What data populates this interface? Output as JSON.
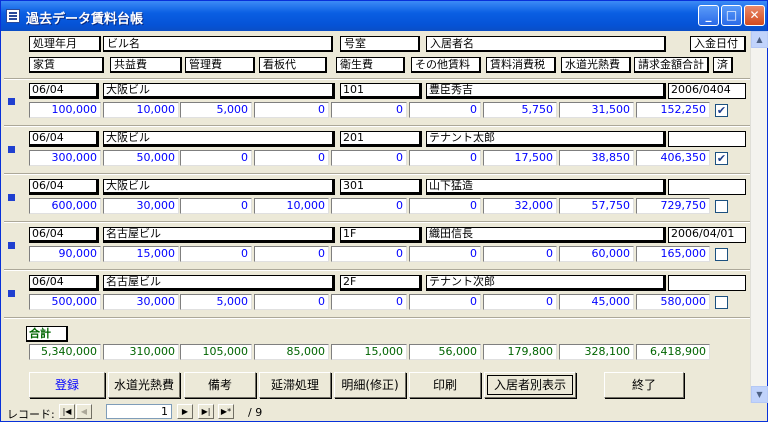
{
  "window": {
    "title": "過去データ賃料台帳",
    "min": "_",
    "max": "□",
    "close": "✕"
  },
  "headers": {
    "row1": [
      "処理年月",
      "ビル名",
      "号室",
      "入居者名",
      "入金日付"
    ],
    "row2": [
      "家賃",
      "共益費",
      "管理費",
      "看板代",
      "衛生費",
      "その他賃料",
      "賃料消費税",
      "水道光熱費",
      "請求金額合計",
      "済"
    ]
  },
  "records": [
    {
      "ym": "06/04",
      "building": "大阪ビル",
      "room": "101",
      "tenant": "豊臣秀吉",
      "date": "2006/0404",
      "values": [
        "100,000",
        "10,000",
        "5,000",
        "0",
        "0",
        "0",
        "5,750",
        "31,500",
        "152,250"
      ],
      "checked": true
    },
    {
      "ym": "06/04",
      "building": "大阪ビル",
      "room": "201",
      "tenant": "テナント太郎",
      "date": "",
      "values": [
        "300,000",
        "50,000",
        "0",
        "0",
        "0",
        "0",
        "17,500",
        "38,850",
        "406,350"
      ],
      "checked": true
    },
    {
      "ym": "06/04",
      "building": "大阪ビル",
      "room": "301",
      "tenant": "山下猛造",
      "date": "",
      "values": [
        "600,000",
        "30,000",
        "0",
        "10,000",
        "0",
        "0",
        "32,000",
        "57,750",
        "729,750"
      ],
      "checked": false
    },
    {
      "ym": "06/04",
      "building": "名古屋ビル",
      "room": "1F",
      "tenant": "織田信長",
      "date": "2006/04/01",
      "values": [
        "90,000",
        "15,000",
        "0",
        "0",
        "0",
        "0",
        "0",
        "60,000",
        "165,000"
      ],
      "checked": false
    },
    {
      "ym": "06/04",
      "building": "名古屋ビル",
      "room": "2F",
      "tenant": "テナント次郎",
      "date": "",
      "values": [
        "500,000",
        "30,000",
        "5,000",
        "0",
        "0",
        "0",
        "0",
        "45,000",
        "580,000"
      ],
      "checked": false
    }
  ],
  "totals": {
    "label": "合計",
    "values": [
      "5,340,000",
      "310,000",
      "105,000",
      "85,000",
      "15,000",
      "56,000",
      "179,800",
      "328,100",
      "6,418,900"
    ]
  },
  "buttons": [
    {
      "label": "登録"
    },
    {
      "label": "水道光熱費"
    },
    {
      "label": "備考"
    },
    {
      "label": "延滞処理"
    },
    {
      "label": "明細(修正)"
    },
    {
      "label": "印刷"
    },
    {
      "label": "入居者別表示"
    },
    {
      "label": "終了"
    }
  ],
  "recordNav": {
    "label": "レコード:",
    "current": "1",
    "total": "/ 9",
    "first": "|◀",
    "prev": "◀",
    "next": "▶",
    "last": "▶|",
    "new": "▶*"
  },
  "scroll": {
    "up": "▲",
    "down": "▼"
  },
  "colors": {
    "titlebar": "#0a5fe3",
    "value": "#0000ff",
    "total": "#006400",
    "selector": "#1f3fd0"
  }
}
